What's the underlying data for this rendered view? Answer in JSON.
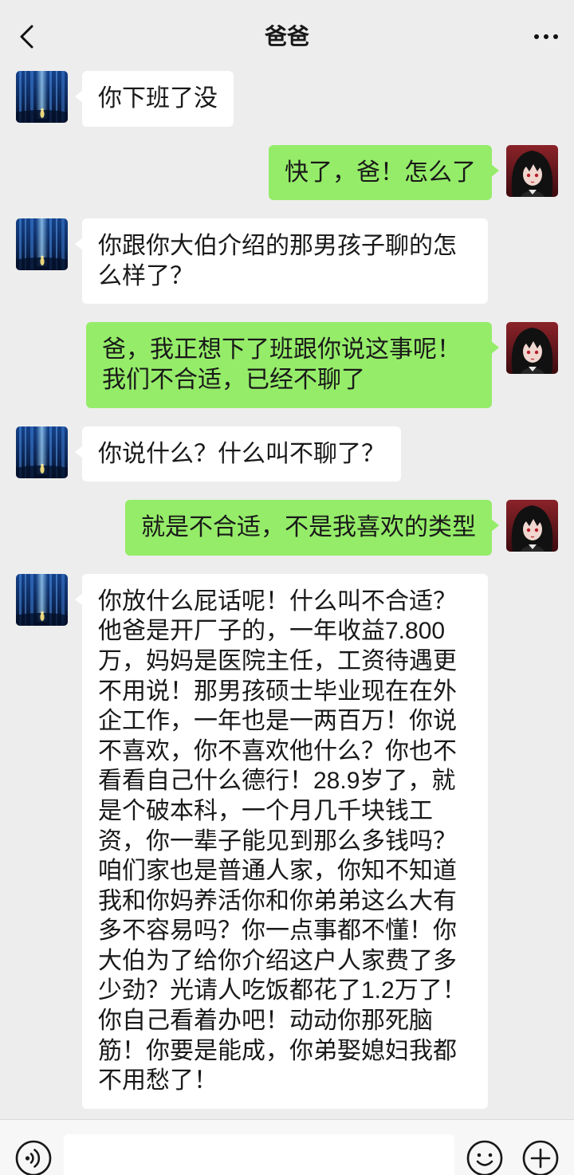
{
  "header": {
    "title": "爸爸",
    "back_icon": "chevron-left-icon",
    "more_icon": "more-dots-icon"
  },
  "colors": {
    "background": "#ededed",
    "incoming_bubble": "#ffffff",
    "outgoing_bubble": "#95ec69",
    "text": "#191919",
    "input_bar": "#f7f7f7"
  },
  "avatars": {
    "incoming": "contact-avatar",
    "outgoing": "self-avatar"
  },
  "messages": [
    {
      "outgoing": false,
      "lines": [
        "你下班了没"
      ]
    },
    {
      "outgoing": true,
      "lines": [
        "快了，爸！怎么了"
      ]
    },
    {
      "outgoing": false,
      "lines": [
        "你跟你大伯介绍的那男孩子聊的怎",
        "么样了？"
      ]
    },
    {
      "outgoing": true,
      "lines": [
        "爸，我正想下了班跟你说这事呢！",
        "我们不合适，已经不聊了"
      ]
    },
    {
      "outgoing": false,
      "lines": [
        "你说什么？什么叫不聊了？"
      ]
    },
    {
      "outgoing": true,
      "lines": [
        "就是不合适，不是我喜欢的类型"
      ]
    },
    {
      "outgoing": false,
      "lines": [
        "你放什么屁话呢！什么叫不合适？",
        "他爸是开厂子的，一年收益7.800",
        "万，妈妈是医院主任，工资待遇更",
        "不用说！那男孩硕士毕业现在在外",
        "企工作，一年也是一两百万！你说",
        "不喜欢，你不喜欢他什么？你也不",
        "看看自己什么德行！28.9岁了，就",
        "是个破本科，一个月几千块钱工",
        "资，你一辈子能见到那么多钱吗？",
        "咱们家也是普通人家，你知不知道",
        "我和你妈养活你和你弟弟这么大有",
        "多不容易吗？你一点事都不懂！你",
        "大伯为了给你介绍这户人家费了多",
        "少劲？光请人吃饭都花了1.2万了！",
        "你自己看着办吧！动动你那死脑",
        "筋！你要是能成，你弟娶媳妇我都",
        "不用愁了！"
      ]
    }
  ],
  "input_bar": {
    "voice_icon": "voice-icon",
    "message_value": "",
    "emoji_icon": "emoji-icon",
    "plus_icon": "plus-icon"
  }
}
